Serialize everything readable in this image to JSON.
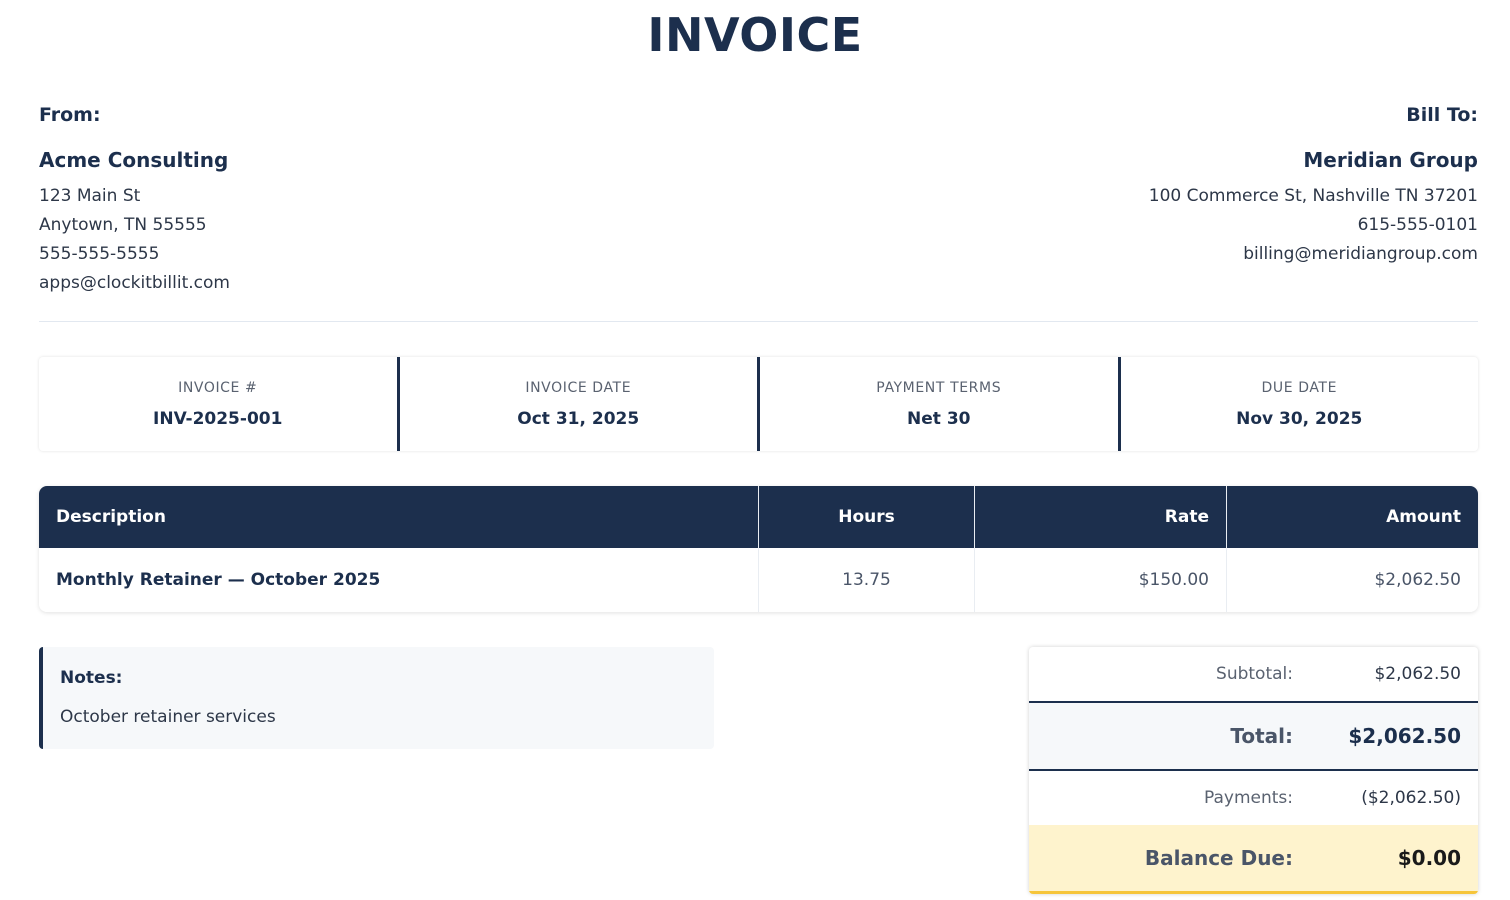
{
  "title": "INVOICE",
  "from": {
    "label": "From:",
    "name": "Acme Consulting",
    "lines": [
      "123 Main St",
      "Anytown, TN 55555",
      "555-555-5555",
      "apps@clockitbillit.com"
    ]
  },
  "bill_to": {
    "label": "Bill To:",
    "name": "Meridian Group",
    "lines": [
      "100 Commerce St, Nashville TN 37201",
      "615-555-0101",
      "billing@meridiangroup.com"
    ]
  },
  "meta": [
    {
      "label": "INVOICE #",
      "value": "INV-2025-001"
    },
    {
      "label": "INVOICE DATE",
      "value": "Oct 31, 2025"
    },
    {
      "label": "PAYMENT TERMS",
      "value": "Net 30"
    },
    {
      "label": "DUE DATE",
      "value": "Nov 30, 2025"
    }
  ],
  "items": {
    "headers": {
      "description": "Description",
      "hours": "Hours",
      "rate": "Rate",
      "amount": "Amount"
    },
    "rows": [
      {
        "description": "Monthly Retainer — October 2025",
        "hours": "13.75",
        "rate": "$150.00",
        "amount": "$2,062.50"
      }
    ]
  },
  "notes": {
    "title": "Notes:",
    "text": "October retainer services"
  },
  "totals": {
    "subtotal_label": "Subtotal:",
    "subtotal": "$2,062.50",
    "total_label": "Total:",
    "total": "$2,062.50",
    "payments_label": "Payments:",
    "payments": "($2,062.50)",
    "balance_label": "Balance Due:",
    "balance": "$0.00"
  },
  "colors": {
    "primary": "#1c2f4d",
    "balance_bg": "#fef3cd",
    "balance_accent": "#f6c53a"
  }
}
